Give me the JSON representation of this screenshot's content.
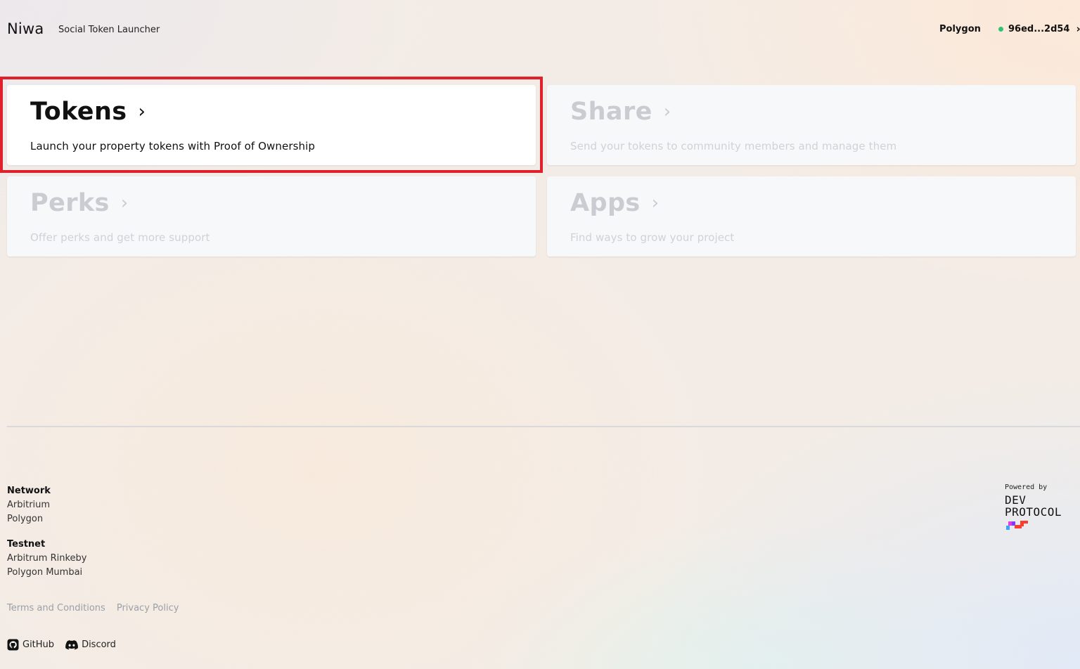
{
  "header": {
    "brand": "Niwa",
    "tagline": "Social Token Launcher",
    "network": "Polygon",
    "wallet": {
      "address": "96ed...2d54",
      "status_color": "#2ec472"
    }
  },
  "cards": [
    {
      "title": "Tokens",
      "description": "Launch your property tokens with Proof of Ownership",
      "state": "active"
    },
    {
      "title": "Share",
      "description": "Send your tokens to community members and manage them",
      "state": "disabled"
    },
    {
      "title": "Perks",
      "description": "Offer perks and get more support",
      "state": "disabled"
    },
    {
      "title": "Apps",
      "description": "Find ways to grow your project",
      "state": "disabled"
    }
  ],
  "highlight_color": "#e0202a",
  "footer": {
    "network": {
      "heading": "Network",
      "items": [
        "Arbitrium",
        "Polygon"
      ]
    },
    "testnet": {
      "heading": "Testnet",
      "items": [
        "Arbitrum Rinkeby",
        "Polygon Mumbai"
      ]
    },
    "legal": {
      "terms": "Terms and Conditions",
      "privacy": "Privacy Policy"
    },
    "social": {
      "github": "GitHub",
      "discord": "Discord"
    },
    "powered": {
      "label": "Powered by",
      "logo_line1": "DEV",
      "logo_line2": "PROTOCOL"
    }
  }
}
